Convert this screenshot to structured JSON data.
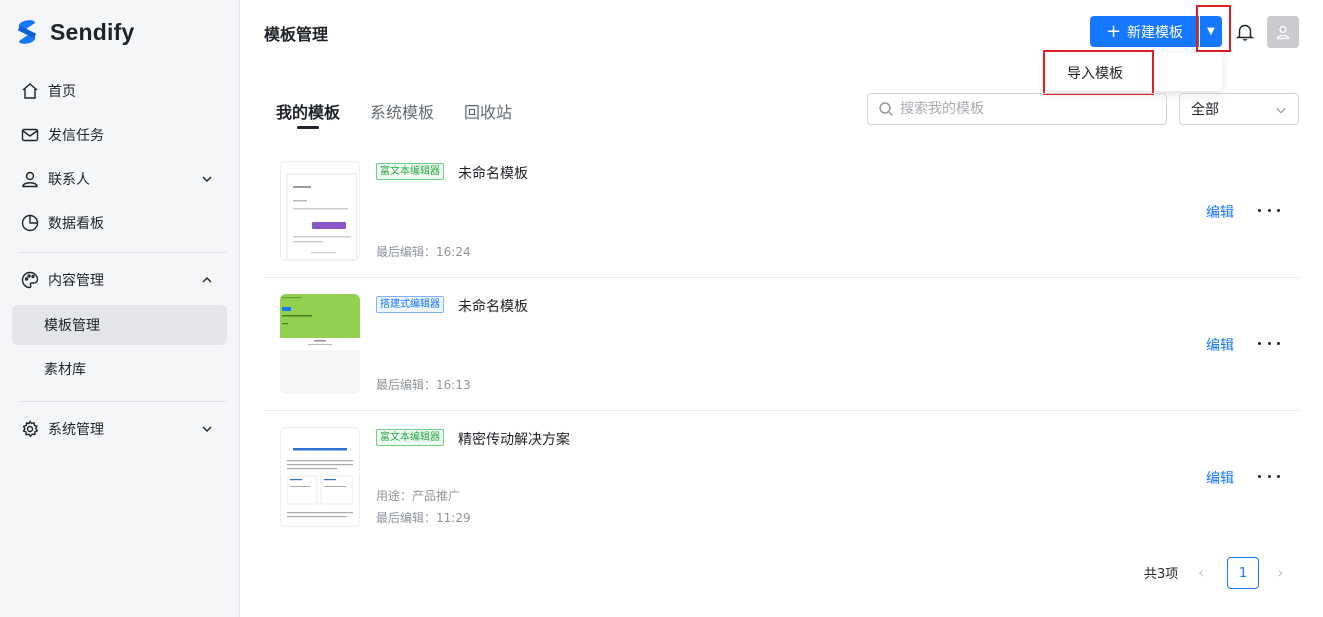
{
  "brand": {
    "name": "Sendify",
    "color": "#1677ff"
  },
  "sidebar": {
    "items": [
      {
        "label": "首页",
        "icon": "home-icon"
      },
      {
        "label": "发信任务",
        "icon": "mail-icon"
      },
      {
        "label": "联系人",
        "icon": "user-icon",
        "expandable": true
      },
      {
        "label": "数据看板",
        "icon": "pie-chart-icon"
      },
      {
        "label": "内容管理",
        "icon": "palette-icon",
        "expanded": true,
        "children": [
          {
            "label": "模板管理",
            "active": true
          },
          {
            "label": "素材库"
          }
        ]
      },
      {
        "label": "系统管理",
        "icon": "gear-icon",
        "expandable": true
      }
    ]
  },
  "header": {
    "title": "模板管理",
    "new_button": "新建模板",
    "dropdown_items": [
      "导入模板"
    ]
  },
  "tabs": [
    {
      "label": "我的模板",
      "active": true
    },
    {
      "label": "系统模板"
    },
    {
      "label": "回收站"
    }
  ],
  "search": {
    "placeholder": "搜索我的模板",
    "value": ""
  },
  "filter": {
    "selected": "全部"
  },
  "templates": [
    {
      "badge": "富文本编辑器",
      "badge_color": "green",
      "title": "未命名模板",
      "usage": "",
      "last_edit": "最后编辑：16:24",
      "action": "编辑"
    },
    {
      "badge": "搭建式编辑器",
      "badge_color": "blue",
      "title": "未命名模板",
      "usage": "",
      "last_edit": "最后编辑：16:13",
      "action": "编辑"
    },
    {
      "badge": "富文本编辑器",
      "badge_color": "green",
      "title": "精密传动解决方案",
      "usage": "用途：产品推广",
      "last_edit": "最后编辑：11:29",
      "action": "编辑"
    }
  ],
  "pagination": {
    "total": "共3项",
    "current": "1"
  }
}
